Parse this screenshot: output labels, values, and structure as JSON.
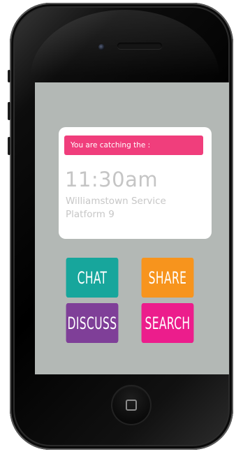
{
  "card": {
    "banner": "You are catching the :",
    "time": "11:30am",
    "service_line1": "Williamstown Service",
    "service_line2": "Platform 9"
  },
  "actions": {
    "chat": "CHAT",
    "share": "SHARE",
    "discuss": "DISCUSS",
    "search": "SEARCH"
  },
  "colors": {
    "screen_bg": "#b3b8b5",
    "banner": "#f03e7c",
    "chat": "#17a69c",
    "share": "#f7941d",
    "discuss": "#7f3f98",
    "search": "#ec1d8c"
  },
  "icons": {
    "home_button": "home-square-icon"
  }
}
